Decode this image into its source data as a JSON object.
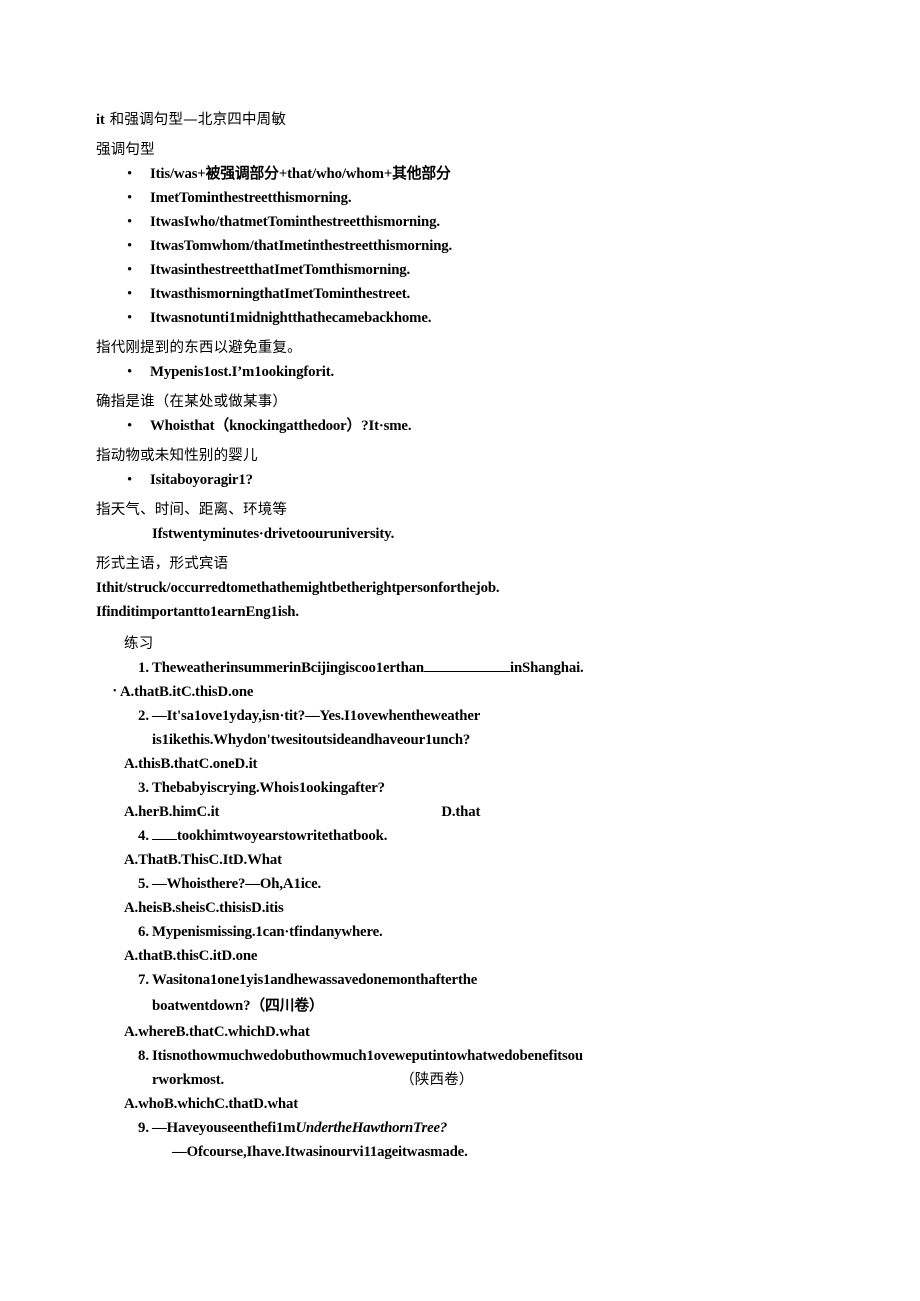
{
  "document": {
    "title_latin": "it",
    "title_cn": " 和强调句型—北京四中周敏",
    "heading_1": "强调句型",
    "emphasis_bullets": [
      "Itis/was+被强调部分+that/who/whom+其他部分",
      "ImetTominthestreetthismorning.",
      "ItwasIwho/thatmetTominthestreetthismorning.",
      "ItwasTomwhom/thatImetinthestreetthismorning.",
      "ItwasinthestreetthatImetTomthismorning.",
      "ItwasthismorningthatImetTominthestreet.",
      "Itwasnotunti1midnightthathecamebackhome."
    ],
    "section_2_head": "指代刚提到的东西以避免重复。",
    "section_2_bullets": [
      "Mypenis1ost.I’m1ookingforit."
    ],
    "section_3_head": "确指是谁（在某处或做某事）",
    "section_3_bullets": [
      "Whoisthat（knockingatthedoor）?It·sme."
    ],
    "section_4_head": "指动物或未知性别的婴儿",
    "section_4_bullets": [
      "Isitaboyoragir1?"
    ],
    "section_5_head": "指天气、时间、距离、环境等",
    "section_5_line": "Ifstwentyminutes·drivetoouruniversity.",
    "section_6_head": "形式主语，形式宾语",
    "section_6_lines": [
      "Ithit/struck/occurredtomethathemightbetherightpersonforthejob.",
      "Ifinditimportantto1earnEng1ish."
    ]
  },
  "exercises": {
    "title": "练习",
    "items": [
      {
        "num": "1.",
        "text_before": "TheweatherinsummerinBcijingiscoo1erthan",
        "blank": "long",
        "text_after": "inShanghai.",
        "options": "A.thatB.itC.thisD.one",
        "options_style": "bullet"
      },
      {
        "num": "2.",
        "text_before": "—It'sa1ove1yday,isn·tit?—Yes.I1ovewhentheweather",
        "continuation": "is1ikethis.Whydon'twesitoutsideandhaveour1unch?",
        "options": "A.thisB.thatC.oneD.it",
        "options_style": "plain"
      },
      {
        "num": "3.",
        "text_before": "Thebabyiscrying.Whois1ookingafter?",
        "options": "A.herB.himC.it",
        "options_trail": "D.that",
        "options_style": "plain-trail"
      },
      {
        "num": "4.",
        "blank_leading": "short",
        "text_after": "tookhimtwoyearstowritethatbook.",
        "options": "A.ThatB.ThisC.ItD.What",
        "options_style": "plain"
      },
      {
        "num": "5.",
        "text_before": "—Whoisthere?—Oh,A1ice.",
        "options": "A.heisB.sheisC.thisisD.itis",
        "options_style": "plain"
      },
      {
        "num": "6.",
        "text_before": "Mypenismissing.1can·tfindanywhere.",
        "options": "A.thatB.thisC.itD.one",
        "options_style": "plain"
      },
      {
        "num": "7.",
        "text_before": "Wasitona1one1yis1andhewassavedonemonthafterthe",
        "continuation": "boatwentdown?（四川卷）",
        "options": "A.whereB.thatC.whichD.what",
        "options_style": "plain"
      },
      {
        "num": "8.",
        "text_before": "Itisnothowmuchwedobuthowmuch1oveweputintowhatwedobenefitsou",
        "continuation": "rworkmost.",
        "continuation_trail": "（陕西卷）",
        "options": "A.whoB.whichC.thatD.what",
        "options_style": "plain"
      },
      {
        "num": "9.",
        "text_before": "—Haveyouseenthefi1m",
        "text_italic": "UndertheHawthornTree?",
        "continuation": "—Ofcourse,Ihave.Itwasinourvi11ageitwasmade."
      }
    ]
  }
}
